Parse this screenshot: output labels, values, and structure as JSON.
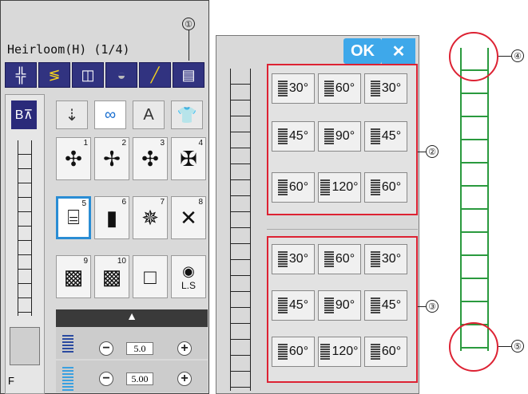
{
  "left_panel": {
    "title": "Heirloom(H) (1/4)",
    "toolbar_icons": [
      "stitch-type-icon",
      "zigzag-icon",
      "mirror-icon",
      "elongation-icon",
      "needle-icon",
      "ladder-stitch-icon"
    ],
    "categories": [
      "category-1",
      "category-2",
      "A",
      "shirt"
    ],
    "stitches": [
      {
        "num": "1",
        "glyph": "✣"
      },
      {
        "num": "2",
        "glyph": "✢"
      },
      {
        "num": "3",
        "glyph": "✣"
      },
      {
        "num": "4",
        "glyph": "✠"
      },
      {
        "num": "5",
        "glyph": "⌸"
      },
      {
        "num": "6",
        "glyph": "▮"
      },
      {
        "num": "7",
        "glyph": "✵"
      },
      {
        "num": "8",
        "glyph": "✕"
      },
      {
        "num": "9",
        "glyph": "▩"
      },
      {
        "num": "10",
        "glyph": "▩"
      },
      {
        "num": "",
        "glyph": "□"
      },
      {
        "num": "",
        "glyph": "◉"
      }
    ],
    "ls_label": "L.S",
    "foot_label": "F",
    "width_value": "5.0",
    "length_value": "5.00"
  },
  "callouts": [
    "①",
    "②",
    "③",
    "④",
    "⑤"
  ],
  "middle_panel": {
    "ok_label": "OK",
    "close_label": "✕",
    "top_buttons": [
      "30°",
      "60°",
      "30°",
      "45°",
      "90°",
      "45°",
      "60°",
      "120°",
      "60°"
    ],
    "bottom_buttons": [
      "30°",
      "60°",
      "30°",
      "45°",
      "90°",
      "45°",
      "60°",
      "120°",
      "60°"
    ]
  },
  "colors": {
    "toolbar": "#313380",
    "ok_button": "#3ea8ea",
    "highlight": "#dd2233",
    "ladder_green": "#2a9a3e"
  }
}
